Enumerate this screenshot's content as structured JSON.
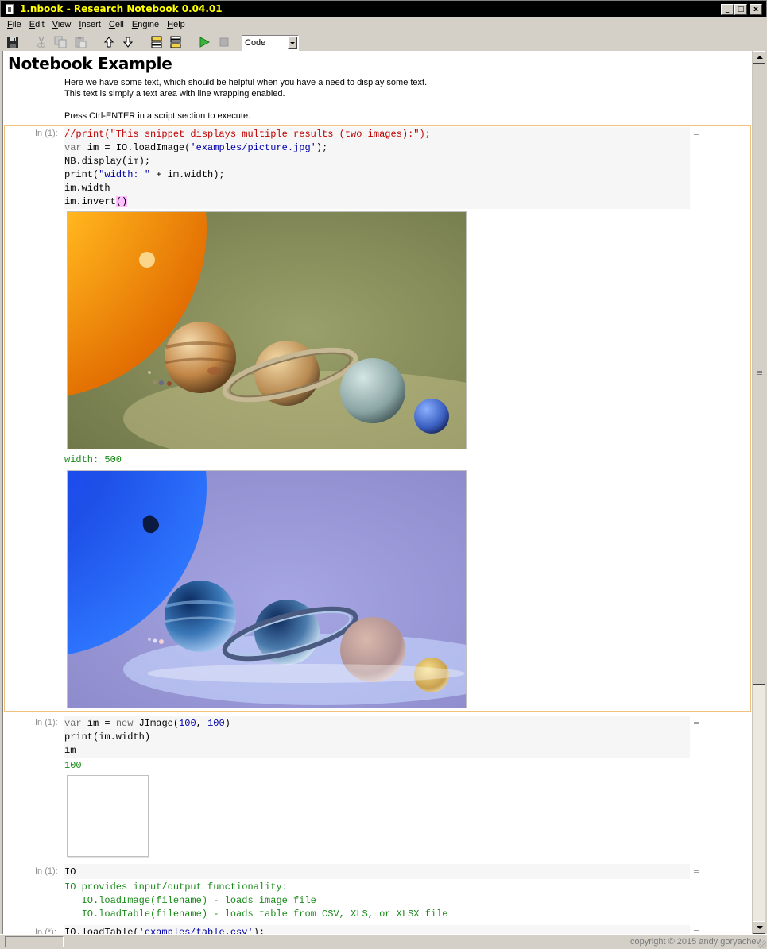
{
  "window": {
    "title": "1.nbook  - Research Notebook 0.04.01",
    "minimize": "_",
    "maximize": "□",
    "close": "x"
  },
  "menu": [
    {
      "accel": "F",
      "rest": "ile"
    },
    {
      "accel": "E",
      "rest": "dit"
    },
    {
      "accel": "V",
      "rest": "iew"
    },
    {
      "accel": "I",
      "rest": "nsert"
    },
    {
      "accel": "C",
      "rest": "ell"
    },
    {
      "accel": "E",
      "rest": "ngine"
    },
    {
      "accel": "H",
      "rest": "elp"
    }
  ],
  "toolbar": {
    "icons": [
      "save-icon",
      "cut-icon",
      "copy-icon",
      "paste-icon",
      "move-up-icon",
      "move-down-icon",
      "insert-above-icon",
      "insert-below-icon",
      "run-icon",
      "stop-icon"
    ],
    "cell_type": "Code"
  },
  "notebook": {
    "title": "Notebook Example",
    "md_line1": "Here we have some text, which should be helpful when you have a need to display some text.",
    "md_line2": "This text is simply a text area with line wrapping enabled.",
    "md_line3": "Press Ctrl-ENTER in a script section to execute.",
    "cell1": {
      "prompt": "In (1):",
      "l1": "//print(\"This snippet displays multiple results (two images):\");",
      "l2_kw": "var",
      "l2_a": " im = IO.loadImage(",
      "l2_str": "'examples/picture.jpg'",
      "l2_b": ");",
      "l3": "NB.display(im);",
      "l4_a": "print(",
      "l4_str": "\"width: \"",
      "l4_b": " + im.width);",
      "l5": "im.width",
      "l6_a": "im.invert",
      "l6_paren": "()",
      "output": "width: 500"
    },
    "cell2": {
      "prompt": "In (1):",
      "l1_kw": "var",
      "l1_a": " im = ",
      "l1_kw2": "new",
      "l1_b": " JImage(",
      "l1_n1": "100",
      "l1_c": ", ",
      "l1_n2": "100",
      "l1_d": ")",
      "l2": "print(im.width)",
      "l3": "im",
      "output": "100"
    },
    "cell3": {
      "prompt": "In (1):",
      "code": "IO",
      "out1": "IO provides input/output functionality:",
      "out2": "   IO.loadImage(filename) - loads image file",
      "out3": "   IO.loadTable(filename) - loads table from CSV, XLS, or XLSX file"
    },
    "cell4": {
      "prompt": "In (*):",
      "l1_a": "IO.loadTable(",
      "l1_str": "'examples/table.csv'",
      "l1_b": ");"
    }
  },
  "status": {
    "copyright": "copyright © 2015 andy goryachev"
  },
  "colors": {
    "accent_frame": "#f0c27b",
    "margin": "#f08080",
    "output": "#1a8a1a",
    "comment": "#c00000",
    "string": "#0000aa"
  }
}
